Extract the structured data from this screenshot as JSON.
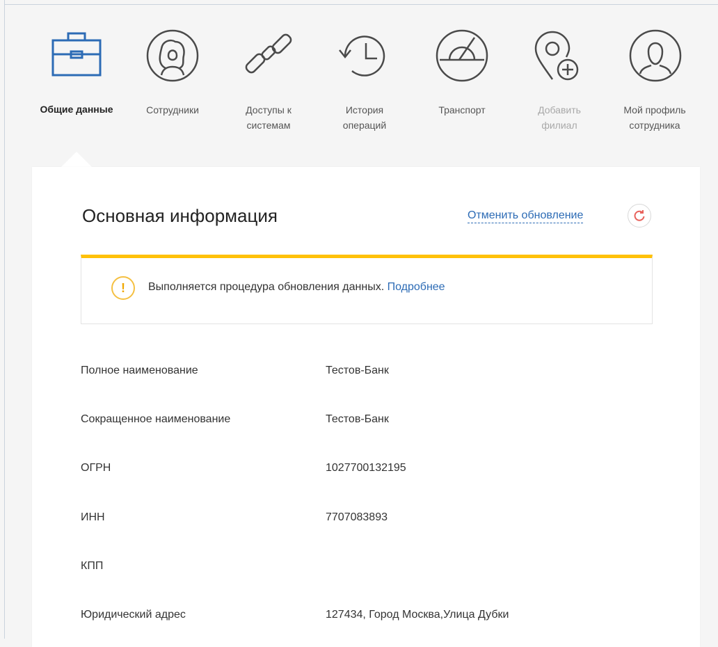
{
  "nav": {
    "items": [
      {
        "label": "Общие данные",
        "icon": "briefcase-icon",
        "state": "active"
      },
      {
        "label": "Сотрудники",
        "icon": "employees-icon",
        "state": "normal"
      },
      {
        "label": "Доступы к\nсистемам",
        "icon": "chain-link-icon",
        "state": "normal"
      },
      {
        "label": "История\nопераций",
        "icon": "history-icon",
        "state": "normal"
      },
      {
        "label": "Транспорт",
        "icon": "speedometer-icon",
        "state": "normal"
      },
      {
        "label": "Добавить\nфилиал",
        "icon": "add-location-icon",
        "state": "disabled"
      },
      {
        "label": "Мой профиль\nсотрудника",
        "icon": "user-profile-icon",
        "state": "normal"
      }
    ],
    "accent_color": "#2c6bb5",
    "icon_color": "#4a4a4a"
  },
  "section": {
    "title": "Основная информация",
    "cancel_update": "Отменить обновление",
    "refresh_icon": "refresh-icon"
  },
  "alert": {
    "text": "Выполняется процедура обновления данных.",
    "link": "Подробнее",
    "icon": "warning-icon",
    "accent_color": "#ffc107"
  },
  "fields": [
    {
      "label": "Полное наименование",
      "value": "Тестов-Банк"
    },
    {
      "label": "Сокращенное наименование",
      "value": "Тестов-Банк"
    },
    {
      "label": "ОГРН",
      "value": "1027700132195"
    },
    {
      "label": "ИНН",
      "value": "7707083893"
    },
    {
      "label": "КПП",
      "value": ""
    },
    {
      "label": "Юридический адрес",
      "value": "127434, Город Москва,Улица Дубки"
    }
  ]
}
